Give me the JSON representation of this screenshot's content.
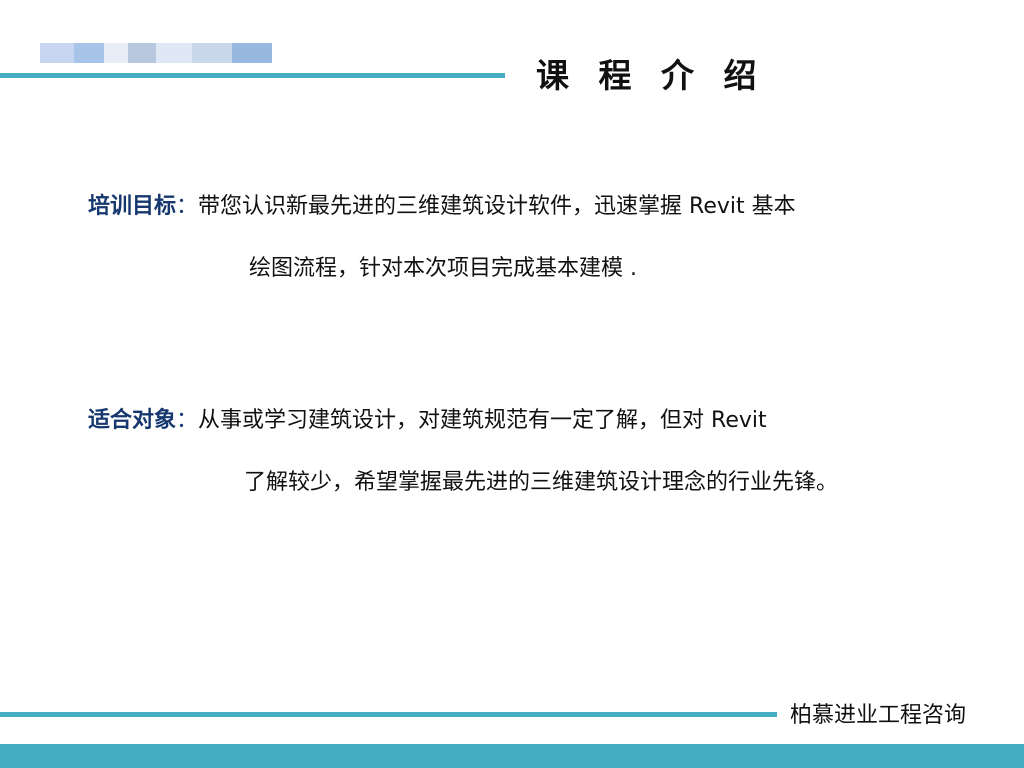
{
  "header": {
    "logo": {
      "name": "blurred-company-logo",
      "colors": [
        "#c7d5f0",
        "#a9c4e9",
        "#e8eef8",
        "#b7c8df",
        "#dfe8f4",
        "#c9d7eb",
        "#99b8df"
      ]
    },
    "title": "课 程 介 绍",
    "accent_color": "#46aec3"
  },
  "content": {
    "objective": {
      "label": "培训目标",
      "colon": "：",
      "line1": "带您认识新最先进的三维建筑设计软件，迅速掌握 Revit 基本",
      "line2": "绘图流程，针对本次项目完成基本建模 ."
    },
    "audience": {
      "label": "适合对象",
      "colon": "：",
      "line1": "从事或学习建筑设计，对建筑规范有一定了解，但对 Revit",
      "line2": "了解较少，希望掌握最先进的三维建筑设计理念的行业先锋。"
    },
    "label_color": "#17386e"
  },
  "footer": {
    "company": "柏慕进业工程咨询",
    "band_color": "#46aec3"
  }
}
